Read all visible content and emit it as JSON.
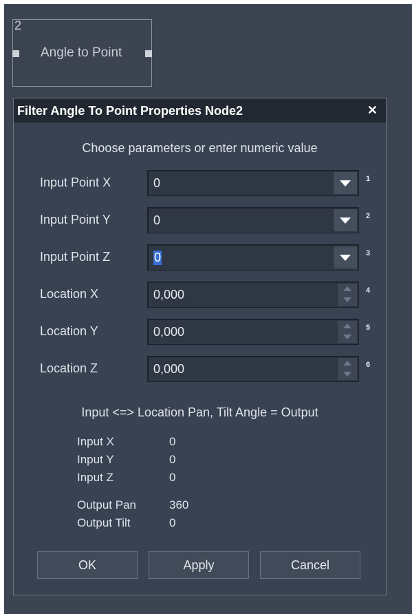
{
  "node": {
    "index": "2",
    "label": "Angle to Point"
  },
  "dialog": {
    "title": "Filter Angle To Point Properties Node2",
    "close_label": "✕",
    "instruction": "Choose parameters or enter numeric value",
    "fields": [
      {
        "label": "Input Point X",
        "value": "0",
        "number": "1",
        "kind": "dropdown"
      },
      {
        "label": "Input Point Y",
        "value": "0",
        "number": "2",
        "kind": "dropdown"
      },
      {
        "label": "Input Point Z",
        "value": "0",
        "number": "3",
        "kind": "dropdown",
        "selected": true
      },
      {
        "label": "Location X",
        "value": "0,000",
        "number": "4",
        "kind": "spinner"
      },
      {
        "label": "Location Y",
        "value": "0,000",
        "number": "5",
        "kind": "spinner"
      },
      {
        "label": "Location Z",
        "value": "0,000",
        "number": "6",
        "kind": "spinner"
      }
    ],
    "formula": "Input <=> Location  Pan, Tilt Angle = Output",
    "info": [
      {
        "label": "Input X",
        "value": "0"
      },
      {
        "label": "Input Y",
        "value": "0"
      },
      {
        "label": "Input Z",
        "value": "0"
      },
      {
        "label": "Output Pan",
        "value": "360"
      },
      {
        "label": "Output Tilt",
        "value": "0"
      }
    ],
    "buttons": {
      "ok": "OK",
      "apply": "Apply",
      "cancel": "Cancel"
    }
  },
  "colors": {
    "workspace": "#3c4452",
    "dialog_bg": "#384252",
    "titlebar": "#222831",
    "selection": "#3a6fd6"
  }
}
